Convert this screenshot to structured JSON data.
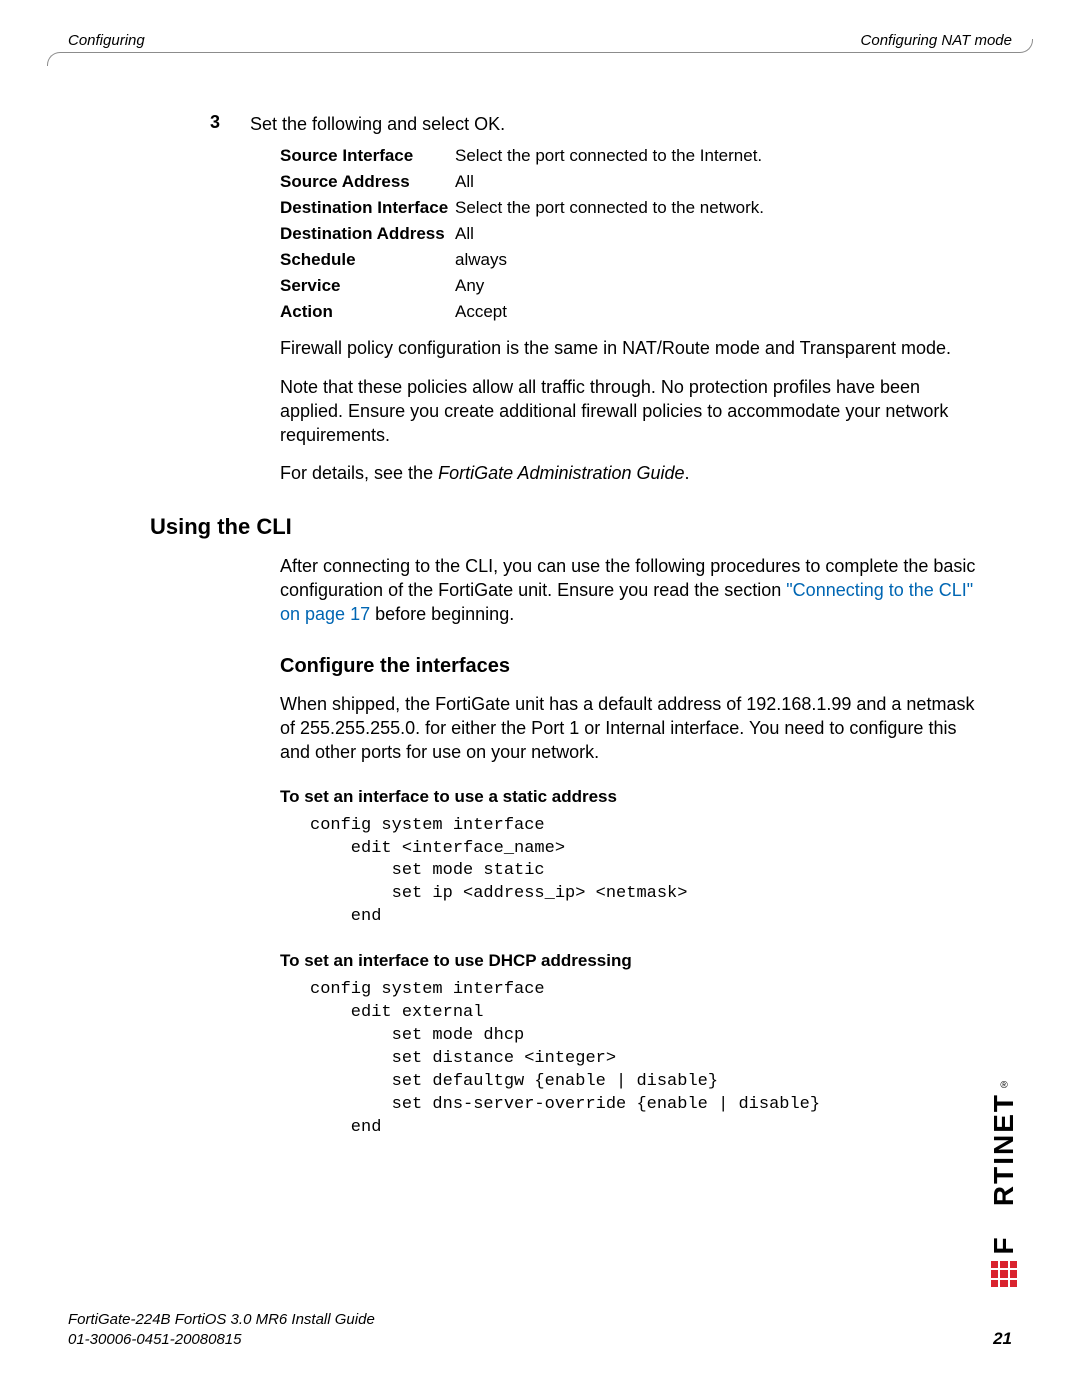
{
  "header": {
    "left": "Configuring",
    "right": "Configuring NAT mode"
  },
  "step": {
    "number": "3",
    "text": "Set the following and select OK."
  },
  "policy": [
    {
      "label": "Source Interface",
      "value": "Select the port connected to the Internet."
    },
    {
      "label": "Source Address",
      "value": "All"
    },
    {
      "label": "Destination Interface",
      "value": "Select the port connected to the network."
    },
    {
      "label": "Destination Address",
      "value": "All"
    },
    {
      "label": "Schedule",
      "value": "always"
    },
    {
      "label": "Service",
      "value": "Any"
    },
    {
      "label": "Action",
      "value": "Accept"
    }
  ],
  "para1": "Firewall policy configuration is the same in NAT/Route mode and Transparent mode.",
  "para2": "Note that these policies allow all traffic through. No protection profiles have been applied. Ensure you create additional firewall policies to accommodate your network requirements.",
  "para3_pre": "For details, see the ",
  "para3_ital": "FortiGate Administration Guide",
  "para3_post": ".",
  "h2_cli": "Using the CLI",
  "cli_intro_pre": "After connecting to the CLI, you can use the following procedures to complete the basic configuration of the FortiGate unit. Ensure you read the section ",
  "cli_intro_link": "\"Connecting to the CLI\" on page 17",
  "cli_intro_post": " before beginning.",
  "h3_conf": "Configure the interfaces",
  "conf_para": "When shipped, the FortiGate unit has a default address of 192.168.1.99 and a netmask of 255.255.255.0. for either the Port 1 or Internal interface. You need to configure this and other ports for use on your network.",
  "h4_static": "To set an interface to use a static address",
  "code_static": "config system interface\n    edit <interface_name>\n        set mode static\n        set ip <address_ip> <netmask>\n    end",
  "h4_dhcp": "To set an interface to use DHCP addressing",
  "code_dhcp": "config system interface\n    edit external\n        set mode dhcp\n        set distance <integer>\n        set defaultgw {enable | disable}\n        set dns-server-override {enable | disable}\n    end",
  "footer": {
    "line1": "FortiGate-224B FortiOS 3.0 MR6 Install Guide",
    "line2": "01-30006-0451-20080815",
    "page": "21"
  },
  "logo_text": "F   RTINET"
}
